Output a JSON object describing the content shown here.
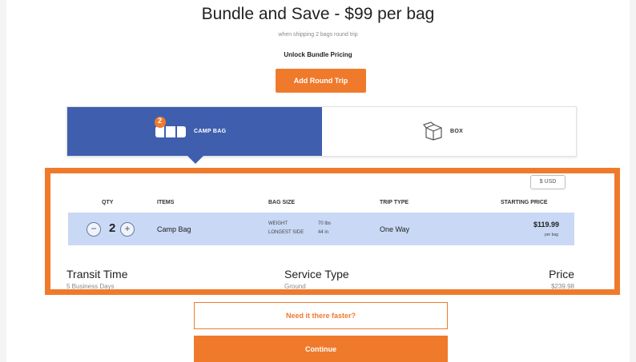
{
  "header": {
    "title": "Bundle and Save - $99 per bag",
    "subtitle": "when shipping 2 bags round trip",
    "unlock_label": "Unlock Bundle Pricing",
    "round_trip_button": "Add Round Trip"
  },
  "tabs": {
    "bag": {
      "label": "CAMP BAG",
      "badge": "2",
      "icon": "bag-icon"
    },
    "box": {
      "label": "BOX",
      "icon": "box-icon"
    }
  },
  "table": {
    "currency": "$ USD",
    "headers": {
      "qty": "QTY",
      "items": "ITEMS",
      "bag_size": "BAG SIZE",
      "trip_type": "TRIP TYPE",
      "starting_price": "STARTING PRICE"
    },
    "row": {
      "qty": "2",
      "item": "Camp Bag",
      "weight_label": "WEIGHT",
      "weight_value": "70 lbs",
      "longest_label": "LONGEST SIDE",
      "longest_value": "44 in",
      "trip_type": "One Way",
      "price": "$119.99",
      "price_unit": "per bag"
    }
  },
  "summary": {
    "transit_label": "Transit Time",
    "transit_value": "5 Business Days",
    "service_label": "Service Type",
    "service_value": "Ground",
    "price_label": "Price",
    "price_value": "$239.98"
  },
  "actions": {
    "faster_button": "Need it there faster?",
    "continue_button": "Continue"
  },
  "colors": {
    "accent": "#ef7a2c",
    "tab_active": "#3f5fae",
    "row_bg": "#c8d8f5"
  }
}
